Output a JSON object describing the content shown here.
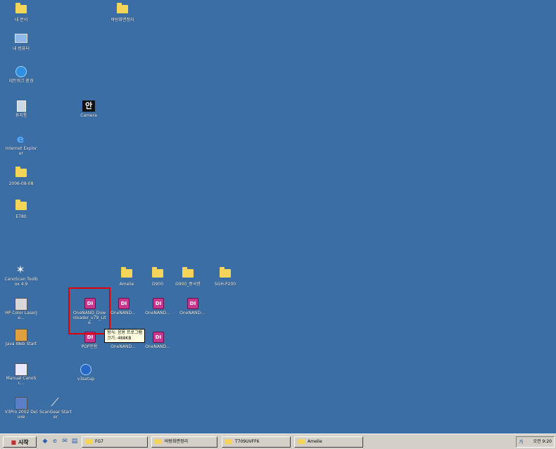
{
  "desktop": {
    "icons": {
      "my_documents": {
        "label": "내 문서",
        "icon": "my-documents-icon"
      },
      "my_computer": {
        "label": "내 컴퓨터",
        "icon": "my-computer-icon"
      },
      "network": {
        "label": "네트워크 환경",
        "icon": "network-icon"
      },
      "recycle_bin": {
        "label": "휴지통",
        "icon": "recycle-bin-icon"
      },
      "internet_explorer": {
        "label": "Internet Explorer",
        "icon": "internet-explorer-icon"
      },
      "folder_2006": {
        "label": "2006-08-08",
        "icon": "folder-icon"
      },
      "folder_e780": {
        "label": "E780",
        "icon": "folder-icon"
      },
      "wallpaper_folder": {
        "label": "바탕화면정리",
        "icon": "folder-icon"
      },
      "camera": {
        "label": "Camera",
        "icon_text": "안",
        "icon": "camera-app-icon"
      },
      "canoscan": {
        "label": "CanoScan Toolbox 4.9",
        "icon": "canoscan-icon"
      },
      "hp_color": {
        "label": "HP Color LaserJe...",
        "icon": "printer-icon"
      },
      "java_web": {
        "label": "Java Web Start",
        "icon": "java-icon"
      },
      "manual_canoscan": {
        "label": "Manual CanoSc...",
        "icon": "manual-icon"
      },
      "v3pro": {
        "label": "V3Pro 2002 Deluxe",
        "icon": "antivirus-icon"
      },
      "scangear": {
        "label": "ScanGear Starter",
        "icon": "scanner-icon"
      },
      "amelie": {
        "label": "Amelie",
        "icon": "folder-icon"
      },
      "d900": {
        "label": "D900",
        "icon": "folder-icon"
      },
      "d900_china": {
        "label": "D900_중국향",
        "icon": "folder-icon"
      },
      "sgh_p200": {
        "label": "SGH-P200",
        "icon": "folder-icon"
      },
      "onenand_dl": {
        "label": "OneNAND_Downloader_v79_Lite",
        "icon_text": "DI",
        "icon": "onenand-app-icon"
      },
      "onenand_2": {
        "label": "OneNAND...",
        "icon_text": "DI",
        "icon": "onenand-app-icon"
      },
      "onenand_3": {
        "label": "OneNAND...",
        "icon_text": "DI",
        "icon": "onenand-app-icon"
      },
      "onenand_4": {
        "label": "OneNAND...",
        "icon_text": "DI",
        "icon": "onenand-app-icon"
      },
      "pop_only": {
        "label": "POP전용",
        "icon_text": "DI",
        "icon": "onenand-app-icon"
      },
      "onenand_5": {
        "label": "OneNAND...",
        "icon_text": "DI",
        "icon": "onenand-app-icon"
      },
      "onenand_6": {
        "label": "OneNAND...",
        "icon_text": "DI",
        "icon": "onenand-app-icon"
      },
      "v3setup": {
        "label": "v3setup",
        "icon": "setup-icon"
      }
    },
    "tooltip": {
      "line1": "형식: 응용 프로그램",
      "line2": "크기: 488KB"
    }
  },
  "taskbar": {
    "start_label": "시작",
    "quick_launch": [
      "desktop-icon",
      "ie-icon",
      "outlook-icon",
      "folder-icon"
    ],
    "tasks": [
      {
        "label": "FG7"
      },
      {
        "label": "바탕화면정리"
      },
      {
        "label": "T709UVFF6"
      },
      {
        "label": "Amelie"
      }
    ],
    "tray": {
      "ime": "가",
      "clock": "오전 9:20"
    }
  },
  "colors": {
    "desktop": "#3a6ea5",
    "taskbar": "#d4d0c8",
    "selection": "#e00000",
    "tooltip": "#ffffe1"
  }
}
